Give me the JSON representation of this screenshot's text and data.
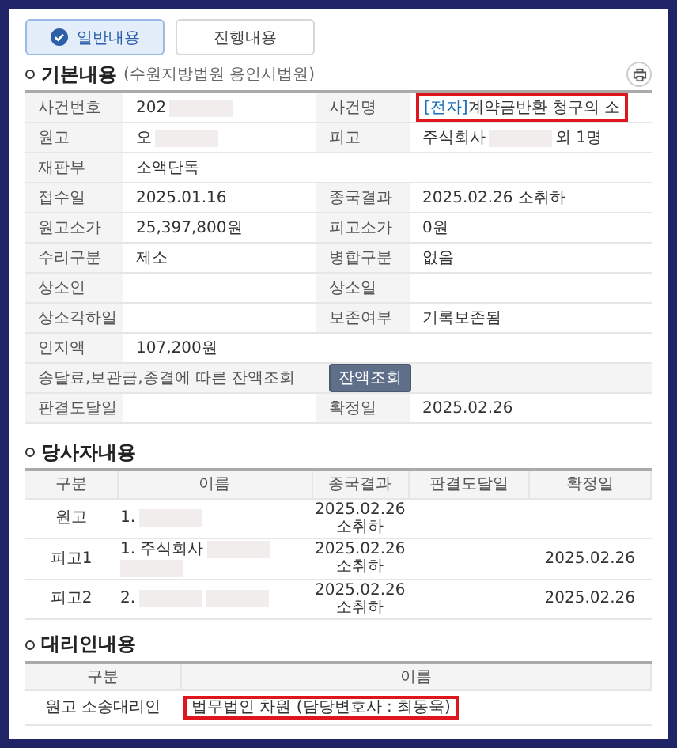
{
  "tabs": [
    {
      "label": "일반내용",
      "selected": true
    },
    {
      "label": "진행내용",
      "selected": false
    }
  ],
  "basic": {
    "title": "기본내용",
    "court": "(수원지방법원 용인시법원)",
    "rows": [
      {
        "kind": "double",
        "fields": [
          {
            "label": "사건번호",
            "parts": [
              {
                "kind": "text",
                "text": "202"
              },
              {
                "kind": "redacted"
              }
            ]
          },
          {
            "label": "사건명",
            "parts": [
              {
                "kind": "highlight",
                "tag": "[전자]",
                "text": "계약금반환 청구의 소"
              }
            ]
          }
        ]
      },
      {
        "kind": "double",
        "fields": [
          {
            "label": "원고",
            "parts": [
              {
                "kind": "text",
                "text": "오"
              },
              {
                "kind": "redacted"
              }
            ]
          },
          {
            "label": "피고",
            "parts": [
              {
                "kind": "text",
                "text": "주식회사"
              },
              {
                "kind": "redacted"
              },
              {
                "kind": "text",
                "text": "외 1명"
              }
            ]
          }
        ]
      },
      {
        "kind": "single",
        "fields": [
          {
            "label": "재판부",
            "parts": [
              {
                "kind": "text",
                "text": "소액단독"
              }
            ]
          }
        ]
      },
      {
        "kind": "double",
        "fields": [
          {
            "label": "접수일",
            "parts": [
              {
                "kind": "text",
                "text": "2025.01.16"
              }
            ]
          },
          {
            "label": "종국결과",
            "parts": [
              {
                "kind": "text",
                "text": "2025.02.26 소취하"
              }
            ]
          }
        ]
      },
      {
        "kind": "double",
        "fields": [
          {
            "label": "원고소가",
            "parts": [
              {
                "kind": "text",
                "text": "25,397,800원"
              }
            ]
          },
          {
            "label": "피고소가",
            "parts": [
              {
                "kind": "text",
                "text": "0원"
              }
            ]
          }
        ]
      },
      {
        "kind": "double",
        "fields": [
          {
            "label": "수리구분",
            "parts": [
              {
                "kind": "text",
                "text": "제소"
              }
            ]
          },
          {
            "label": "병합구분",
            "parts": [
              {
                "kind": "text",
                "text": "없음"
              }
            ]
          }
        ]
      },
      {
        "kind": "double",
        "fields": [
          {
            "label": "상소인"
          },
          {
            "label": "상소일"
          }
        ]
      },
      {
        "kind": "double",
        "fields": [
          {
            "label": "상소각하일"
          },
          {
            "label": "보존여부",
            "parts": [
              {
                "kind": "text",
                "text": "기록보존됨"
              }
            ]
          }
        ]
      },
      {
        "kind": "single",
        "fields": [
          {
            "label": "인지액",
            "parts": [
              {
                "kind": "text",
                "text": "107,200원"
              }
            ]
          }
        ]
      },
      {
        "kind": "action",
        "fields": [
          {
            "label": "송달료,보관금,종결에 따른 잔액조회",
            "parts": [
              {
                "kind": "button",
                "text": "잔액조회"
              }
            ]
          }
        ]
      },
      {
        "kind": "double",
        "fields": [
          {
            "label": "판결도달일"
          },
          {
            "label": "확정일",
            "parts": [
              {
                "kind": "text",
                "text": "2025.02.26"
              }
            ]
          }
        ]
      }
    ]
  },
  "parties": {
    "title": "당사자내용",
    "columns": [
      "구분",
      "이름",
      "종국결과",
      "판결도달일",
      "확정일"
    ],
    "rows": [
      {
        "type": "원고",
        "name": [
          {
            "kind": "text",
            "text": "1."
          },
          {
            "kind": "redacted"
          }
        ],
        "result": "2025.02.26 소취하"
      },
      {
        "type": "피고1",
        "name": [
          {
            "kind": "text",
            "text": "1. 주식회사"
          },
          {
            "kind": "redacted"
          },
          {
            "kind": "redacted"
          }
        ],
        "result": "2025.02.26 소취하",
        "confirmed": "2025.02.26"
      },
      {
        "type": "피고2",
        "name": [
          {
            "kind": "text",
            "text": "2."
          },
          {
            "kind": "redacted"
          },
          {
            "kind": "redacted"
          }
        ],
        "result": "2025.02.26 소취하",
        "confirmed": "2025.02.26"
      }
    ]
  },
  "agents": {
    "title": "대리인내용",
    "columns": [
      "구분",
      "이름"
    ],
    "rows": [
      {
        "type": "원고 소송대리인",
        "name": "법무법인 차원 (담당변호사 : 최동욱)",
        "highlighted": true
      }
    ]
  }
}
